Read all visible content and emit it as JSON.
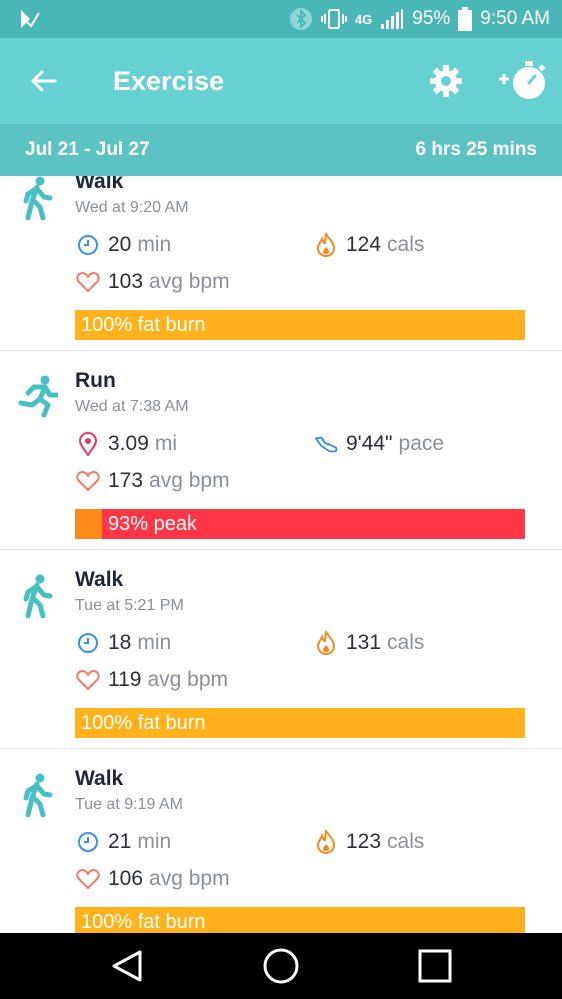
{
  "status_bar": {
    "network": "4G",
    "battery": "95%",
    "time": "9:50 AM"
  },
  "app_bar": {
    "title": "Exercise",
    "icons": [
      "back-arrow-icon",
      "gear-icon",
      "add-timer-icon"
    ]
  },
  "range": {
    "dates": "Jul 21 - Jul 27",
    "total": "6 hrs 25 mins"
  },
  "colors": {
    "app_bar": "#67d0d2",
    "status_bar": "#4ab6b8",
    "fat_burn": "#ffb21c",
    "peak": "#ff3548",
    "cardio": "#ff8a1c",
    "teal_icon": "#48c0c2"
  },
  "activities": [
    {
      "type": "walk",
      "name": "Walk",
      "time": "Wed at 9:20 AM",
      "stat_a": {
        "value": "20",
        "unit": "min",
        "icon": "clock-icon"
      },
      "stat_b": {
        "value": "124",
        "unit": "cals",
        "icon": "flame-icon"
      },
      "stat_c": {
        "value": "103",
        "unit": "avg bpm",
        "icon": "heart-icon"
      },
      "zone": "100% fat burn"
    },
    {
      "type": "run",
      "name": "Run",
      "time": "Wed at 7:38 AM",
      "stat_a": {
        "value": "3.09",
        "unit": "mi",
        "icon": "location-pin-icon"
      },
      "stat_b": {
        "value": "9'44\"",
        "unit": "pace",
        "icon": "shoe-icon"
      },
      "stat_c": {
        "value": "173",
        "unit": "avg bpm",
        "icon": "heart-icon"
      },
      "zone": "93% peak"
    },
    {
      "type": "walk",
      "name": "Walk",
      "time": "Tue at 5:21 PM",
      "stat_a": {
        "value": "18",
        "unit": "min",
        "icon": "clock-icon"
      },
      "stat_b": {
        "value": "131",
        "unit": "cals",
        "icon": "flame-icon"
      },
      "stat_c": {
        "value": "119",
        "unit": "avg bpm",
        "icon": "heart-icon"
      },
      "zone": "100% fat burn"
    },
    {
      "type": "walk",
      "name": "Walk",
      "time": "Tue at 9:19 AM",
      "stat_a": {
        "value": "21",
        "unit": "min",
        "icon": "clock-icon"
      },
      "stat_b": {
        "value": "123",
        "unit": "cals",
        "icon": "flame-icon"
      },
      "stat_c": {
        "value": "106",
        "unit": "avg bpm",
        "icon": "heart-icon"
      },
      "zone": "100% fat burn"
    }
  ],
  "nav": [
    "back-triangle-icon",
    "home-circle-icon",
    "recents-square-icon"
  ]
}
